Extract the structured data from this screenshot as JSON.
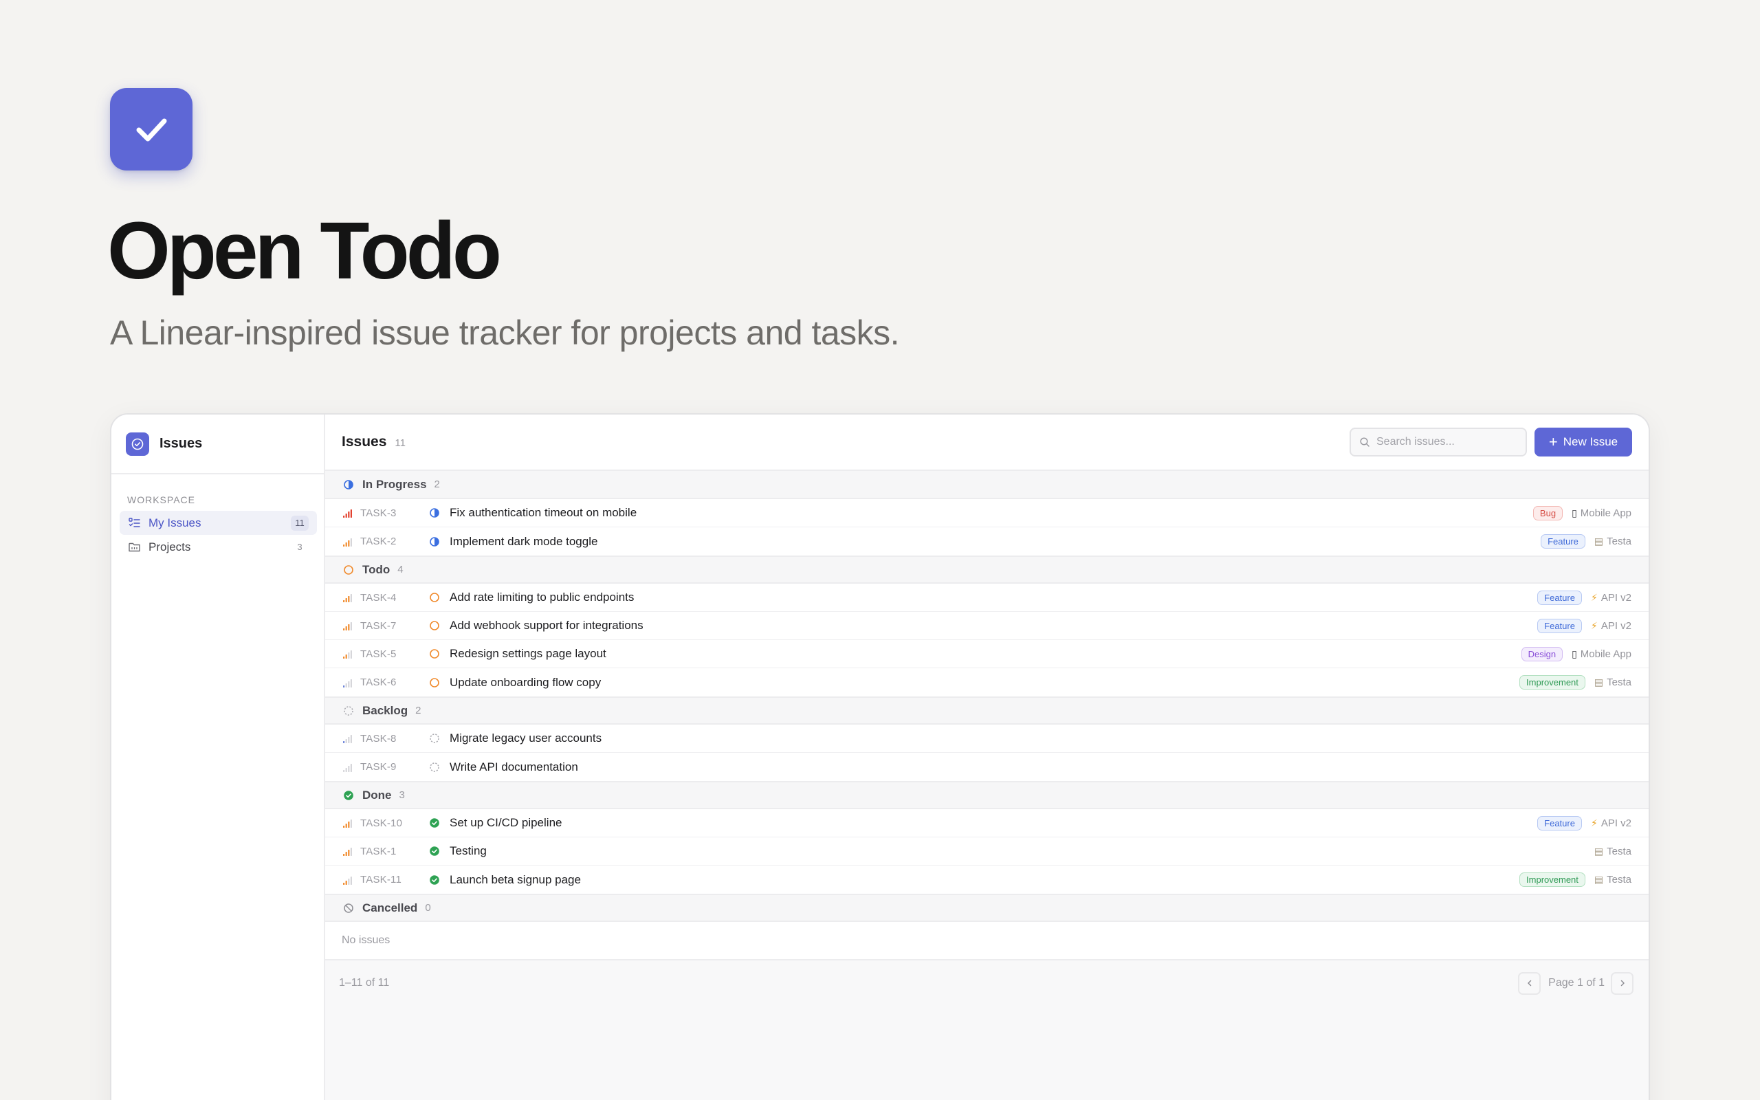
{
  "hero": {
    "title": "Open Todo",
    "subtitle": "A Linear-inspired issue tracker for projects and tasks.",
    "logo_icon": "checkmark-icon",
    "accent": "#5e67d6"
  },
  "sidebar": {
    "app_title": "Issues",
    "section_label": "WORKSPACE",
    "items": [
      {
        "label": "My Issues",
        "count": "11",
        "icon": "list-icon",
        "active": true
      },
      {
        "label": "Projects",
        "count": "3",
        "icon": "folder-icon",
        "active": false
      }
    ]
  },
  "toolbar": {
    "title": "Issues",
    "count": "11",
    "search_placeholder": "Search issues...",
    "new_label": "New Issue"
  },
  "groups": [
    {
      "name": "In Progress",
      "count": "2",
      "status": "in-progress",
      "issues": [
        {
          "id": "TASK-3",
          "title": "Fix authentication timeout on mobile",
          "priority": 4,
          "label": "Bug",
          "project": "Mobile App",
          "project_icon": "phone"
        },
        {
          "id": "TASK-2",
          "title": "Implement dark mode toggle",
          "priority": 3,
          "label": "Feature",
          "project": "Testa",
          "project_icon": "doc"
        }
      ]
    },
    {
      "name": "Todo",
      "count": "4",
      "status": "todo",
      "issues": [
        {
          "id": "TASK-4",
          "title": "Add rate limiting to public endpoints",
          "priority": 3,
          "label": "Feature",
          "project": "API v2",
          "project_icon": "bolt"
        },
        {
          "id": "TASK-7",
          "title": "Add webhook support for integrations",
          "priority": 3,
          "label": "Feature",
          "project": "API v2",
          "project_icon": "bolt"
        },
        {
          "id": "TASK-5",
          "title": "Redesign settings page layout",
          "priority": 2,
          "label": "Design",
          "project": "Mobile App",
          "project_icon": "phone"
        },
        {
          "id": "TASK-6",
          "title": "Update onboarding flow copy",
          "priority": 1,
          "label": "Improvement",
          "project": "Testa",
          "project_icon": "doc"
        }
      ]
    },
    {
      "name": "Backlog",
      "count": "2",
      "status": "backlog",
      "issues": [
        {
          "id": "TASK-8",
          "title": "Migrate legacy user accounts",
          "priority": 1,
          "label": "",
          "project": "",
          "project_icon": ""
        },
        {
          "id": "TASK-9",
          "title": "Write API documentation",
          "priority": 0,
          "label": "",
          "project": "",
          "project_icon": ""
        }
      ]
    },
    {
      "name": "Done",
      "count": "3",
      "status": "done",
      "issues": [
        {
          "id": "TASK-10",
          "title": "Set up CI/CD pipeline",
          "priority": 3,
          "label": "Feature",
          "project": "API v2",
          "project_icon": "bolt"
        },
        {
          "id": "TASK-1",
          "title": "Testing",
          "priority": 3,
          "label": "",
          "project": "Testa",
          "project_icon": "doc"
        },
        {
          "id": "TASK-11",
          "title": "Launch beta signup page",
          "priority": 2,
          "label": "Improvement",
          "project": "Testa",
          "project_icon": "doc"
        }
      ]
    },
    {
      "name": "Cancelled",
      "count": "0",
      "status": "cancelled",
      "issues": [],
      "empty_text": "No issues"
    }
  ],
  "label_colors": {
    "Bug": {
      "bg": "#fdeceb",
      "border": "#f3b8b4",
      "fg": "#d64d45"
    },
    "Feature": {
      "bg": "#ebf1fd",
      "border": "#b7c9f3",
      "fg": "#3f6ad8"
    },
    "Design": {
      "bg": "#f4edfd",
      "border": "#d3bdf2",
      "fg": "#8a4fd8"
    },
    "Improvement": {
      "bg": "#eaf7ee",
      "border": "#b3e0c1",
      "fg": "#2f9a55"
    }
  },
  "status_colors": {
    "in-progress": "#3b6fe0",
    "todo": "#f08a2c",
    "backlog": "#a8a8ae",
    "done": "#2ea253",
    "cancelled": "#8d8d93"
  },
  "footer": {
    "range": "1–11 of 11",
    "page_label": "Page 1 of 1"
  }
}
